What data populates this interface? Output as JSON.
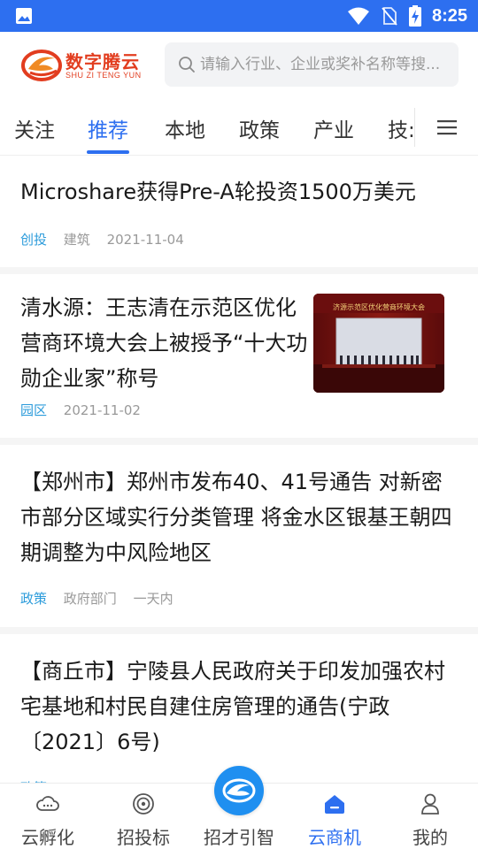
{
  "status_bar": {
    "time": "8:25",
    "icons": [
      "image-notification-icon",
      "wifi-icon",
      "no-sim-icon",
      "battery-charging-icon"
    ]
  },
  "header": {
    "logo_cn": "数字腾云",
    "logo_en": "SHU ZI TENG YUN",
    "search_placeholder": "请输入行业、企业或奖补名称等搜..."
  },
  "tabs": {
    "items": [
      "关注",
      "推荐",
      "本地",
      "政策",
      "产业",
      "技:"
    ],
    "active": "推荐",
    "menu_icon": "hamburger-menu-icon"
  },
  "articles": [
    {
      "title": "Microshare获得Pre-A轮投资1500万美元",
      "tag": "创投",
      "meta": [
        "建筑",
        "2021-11-04"
      ]
    },
    {
      "title": "清水源：王志清在示范区优化营商环境大会上被授予“十大功勋企业家”称号",
      "tag": "园区",
      "meta": [
        "2021-11-02"
      ],
      "thumbnail_caption": "济源示范区优化营商环境大会"
    },
    {
      "title": "【郑州市】郑州市发布40、41号通告 对新密市部分区域实行分类管理 将金水区银基王朝四期调整为中风险地区",
      "tag": "政策",
      "meta": [
        "政府部门",
        "一天内"
      ]
    },
    {
      "title": "【商丘市】宁陵县人民政府关于印发加强农村宅基地和村民自建住房管理的通告(宁政〔2021〕6号)",
      "tag": "政策",
      "meta": []
    }
  ],
  "bottom_nav": {
    "items": [
      {
        "label": "云孵化",
        "icon": "cloud-incubator-icon"
      },
      {
        "label": "招投标",
        "icon": "target-bidding-icon"
      },
      {
        "label": "招才引智",
        "icon": "talent-logo-icon"
      },
      {
        "label": "云商机",
        "icon": "cloud-business-icon"
      },
      {
        "label": "我的",
        "icon": "profile-icon"
      }
    ],
    "active": "云商机"
  },
  "colors": {
    "primary": "#2d6ff0",
    "tag": "#2d9cdb",
    "logo": "#e23d1f",
    "text": "#1a1a1a",
    "muted": "#999999"
  }
}
